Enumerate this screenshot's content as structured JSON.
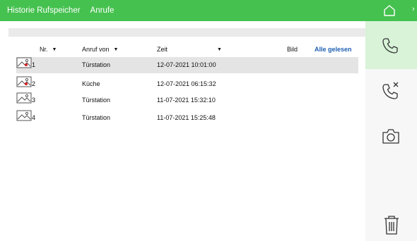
{
  "header": {
    "title": "Historie Rufspeicher",
    "tab": "Anrufe",
    "edge_glyph": "›"
  },
  "table": {
    "columns": {
      "nr": "Nr.",
      "caller": "Anruf von",
      "time": "Zeit",
      "image": "Bild",
      "mark_all_read": "Alle gelesen"
    },
    "rows": [
      {
        "nr": "1",
        "caller": "Türstation",
        "time": "12-07-2021 10:01:00",
        "unread": true,
        "selected": true
      },
      {
        "nr": "2",
        "caller": "Küche",
        "time": "12-07-2021 06:15:32",
        "unread": true,
        "selected": false
      },
      {
        "nr": "3",
        "caller": "Türstation",
        "time": "11-07-2021 15:32:10",
        "unread": false,
        "selected": false
      },
      {
        "nr": "4",
        "caller": "Türstation",
        "time": "11-07-2021 15:25:48",
        "unread": false,
        "selected": false
      }
    ]
  },
  "sidebar": {
    "items": [
      {
        "icon": "home-icon"
      },
      {
        "icon": "phone-icon",
        "active": true
      },
      {
        "icon": "missed-call-icon"
      },
      {
        "icon": "camera-icon"
      },
      {
        "icon": "trash-icon"
      }
    ]
  },
  "colors": {
    "accent": "#45c14f",
    "active_bg": "#d8f3d8",
    "link": "#1d5fb0",
    "unread_dot": "#d61e1e"
  }
}
